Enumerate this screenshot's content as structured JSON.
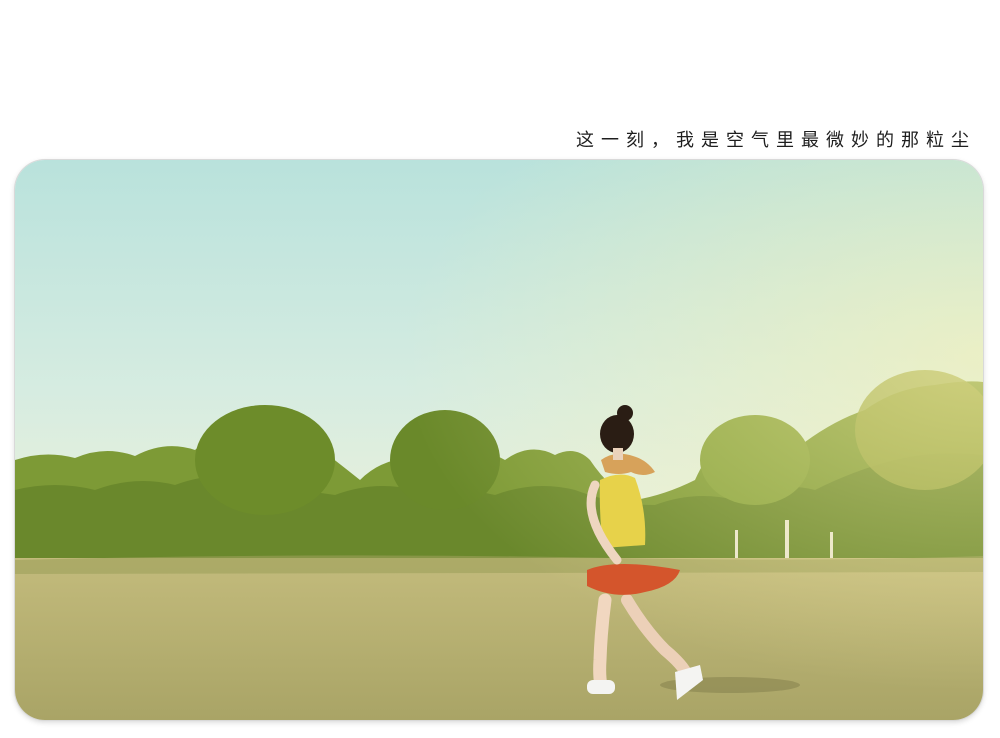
{
  "caption": {
    "text": "这一刻，我是空气里最微妙的那粒尘"
  },
  "photo": {
    "subject": "girl walking on lawn",
    "colors": {
      "sky_top": "#b9e2dc",
      "sky_bottom": "#eaf1d6",
      "trees": "#6f8f2e",
      "grass": "#b6b172",
      "top": "#e7d24a",
      "skirt": "#d4552c",
      "skin": "#f1d7c0",
      "hair": "#2a1d14"
    }
  }
}
